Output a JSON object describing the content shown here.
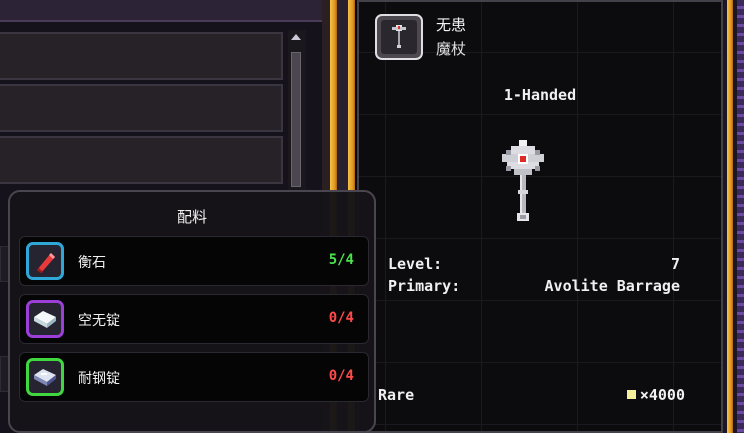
{
  "item": {
    "name": "无患",
    "type": "魔杖",
    "handedness": "1-Handed",
    "icon": "staff-icon",
    "stats": [
      {
        "label": "Level:",
        "value": "7"
      },
      {
        "label": "Primary:",
        "value": "Avolite Barrage"
      }
    ],
    "rarity": "Rare",
    "price": "×4000",
    "price_icon": "pixel-currency-icon"
  },
  "recipe": {
    "title": "配料",
    "ingredients": [
      {
        "name": "衡石",
        "count": "5/4",
        "icon": "red-crystal-icon",
        "frame_color": "#2fa8d8",
        "count_color": "#4be24b"
      },
      {
        "name": "空无锭",
        "count": "0/4",
        "icon": "white-ingot-icon",
        "frame_color": "#9b3fd8",
        "count_color": "#ff4a4a"
      },
      {
        "name": "耐钢锭",
        "count": "0/4",
        "icon": "steel-ingot-icon",
        "frame_color": "#3fd83f",
        "count_color": "#ff4a4a"
      }
    ]
  },
  "colors": {
    "gold": "#f2b83a",
    "panel_bg": "#0c0c0e",
    "sufficient": "#4be24b",
    "insufficient": "#ff4a4a"
  }
}
